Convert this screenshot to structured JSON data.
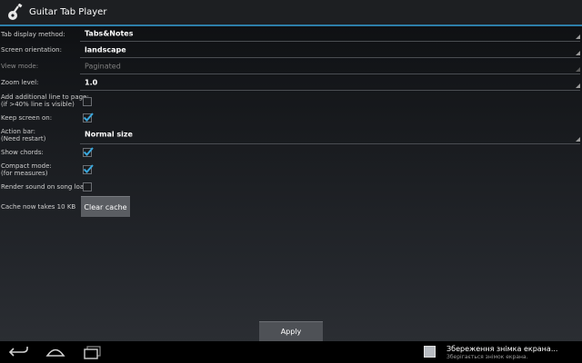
{
  "app": {
    "title": "Guitar Tab Player"
  },
  "settings": {
    "tab_display": {
      "label": "Tab display method:",
      "value": "Tabs&Notes"
    },
    "screen_orientation": {
      "label": "Screen orientation:",
      "value": "landscape"
    },
    "view_mode": {
      "label": "View mode:",
      "value": "Paginated"
    },
    "zoom_level": {
      "label": "Zoom level:",
      "value": "1.0"
    },
    "additional_line": {
      "label_line1": "Add additional line to page:",
      "label_line2": "(if >40% line is visible)",
      "checked": false
    },
    "keep_screen_on": {
      "label": "Keep screen on:",
      "checked": true
    },
    "action_bar": {
      "label_line1": "Action bar:",
      "label_line2": "(Need restart)",
      "value": "Normal size"
    },
    "show_chords": {
      "label": "Show chords:",
      "checked": true
    },
    "compact_mode": {
      "label_line1": "Compact mode:",
      "label_line2": "(for measures)",
      "checked": true
    },
    "render_sound": {
      "label": "Render sound on song load:",
      "checked": false
    },
    "cache": {
      "label": "Cache now takes 10 KB",
      "button": "Clear cache"
    }
  },
  "apply_button": "Apply",
  "notification": {
    "title": "Збереження знімка екрана...",
    "subtitle": "Зберігається знімок екрана."
  },
  "icons": {
    "app": "guitar-icon",
    "back": "back-icon",
    "home": "home-icon",
    "recent": "recent-apps-icon"
  },
  "colors": {
    "accent": "#2d7ea8",
    "check": "#3aa7dc"
  }
}
